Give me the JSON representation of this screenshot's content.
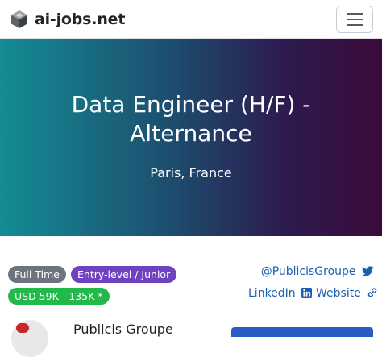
{
  "navbar": {
    "brand_name": "ai-jobs.net",
    "logo_icon": "cube-logo-icon",
    "menu_icon": "hamburger-menu-icon"
  },
  "hero": {
    "title": "Data Engineer (H/F) - Alternance",
    "location": "Paris, France",
    "gradient_colors": [
      "#138c94",
      "#3a0b3a"
    ]
  },
  "tags": {
    "employment_type": "Full Time",
    "level": "Entry-level / Junior",
    "salary": "USD 59K - 135K *"
  },
  "company_links": {
    "twitter": "@PublicisGroupe",
    "linkedin": "LinkedIn",
    "website": "Website"
  },
  "company": {
    "name": "Publicis Groupe"
  },
  "colors": {
    "link": "#1a5fb4",
    "tag_fulltime": "#6c757d",
    "tag_level": "#6f42c1",
    "tag_salary": "#20b94a",
    "apply_button": "#2b5cc5"
  }
}
